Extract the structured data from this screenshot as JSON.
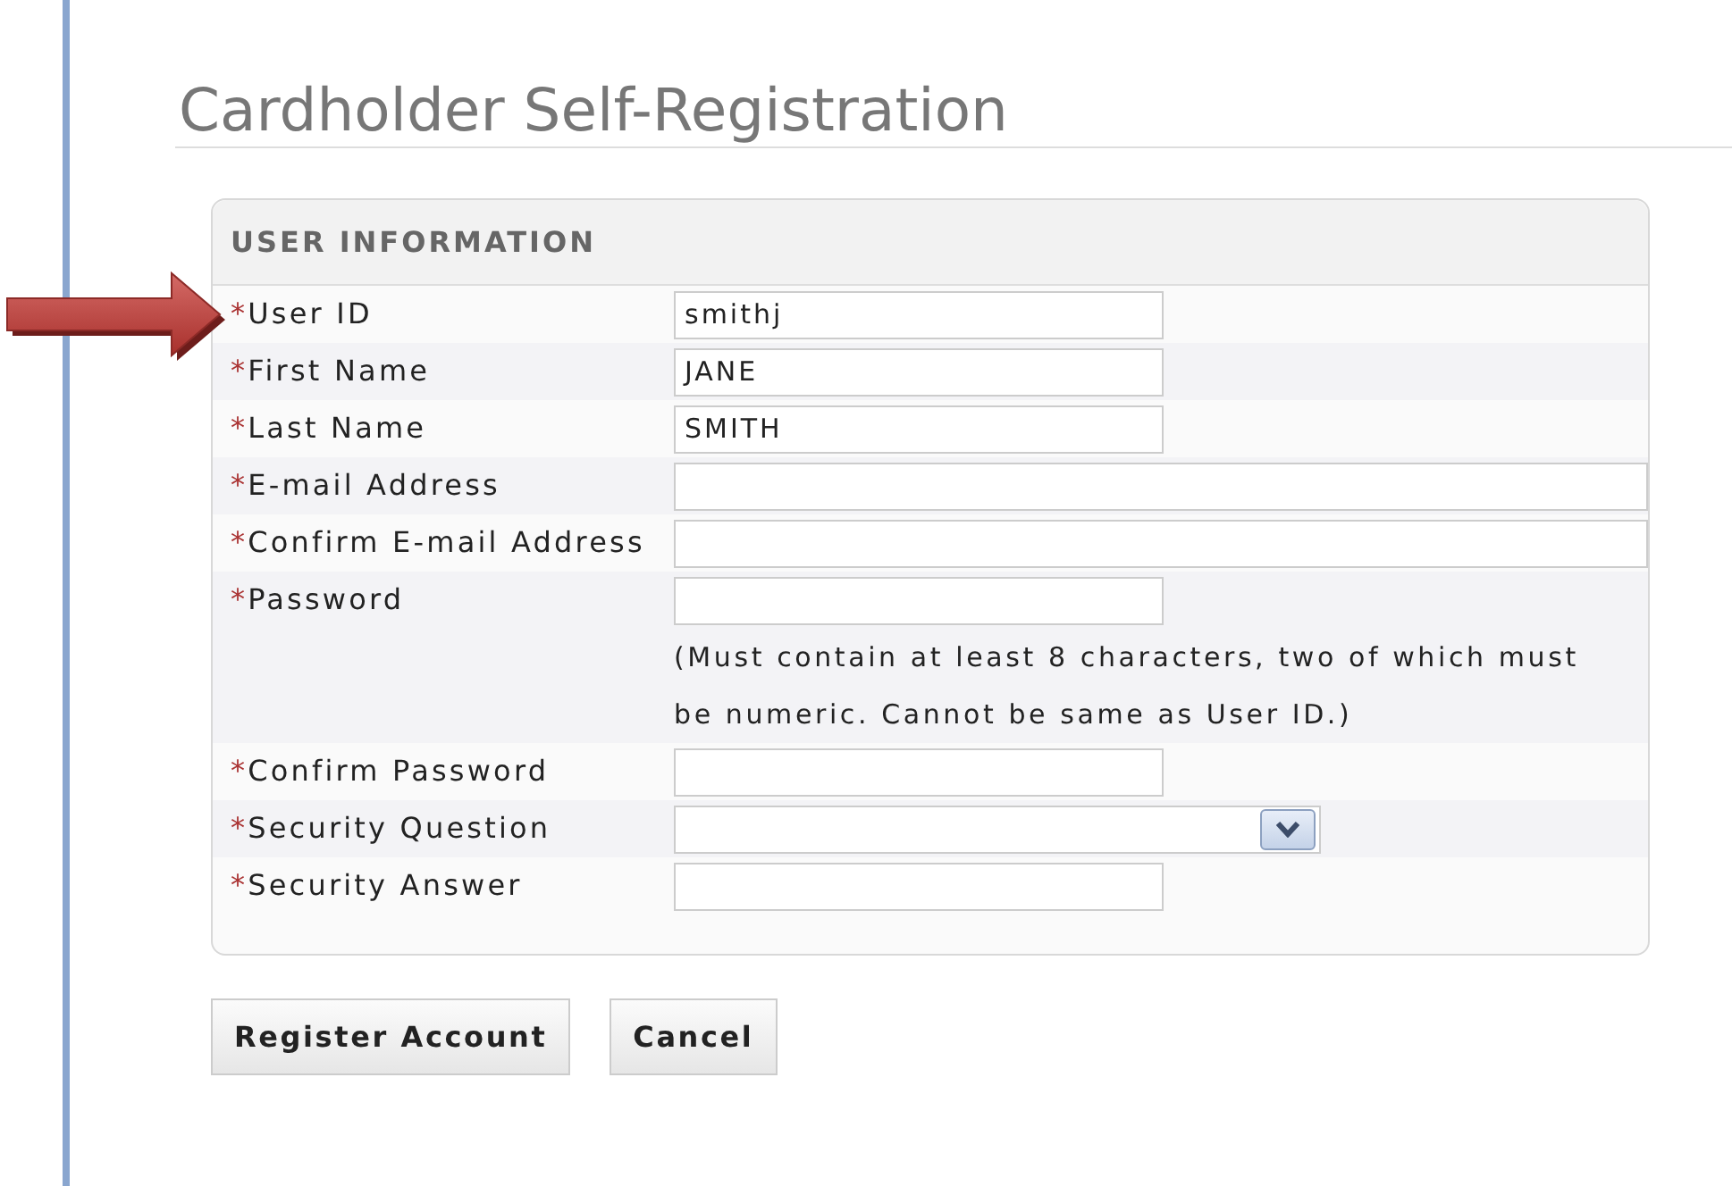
{
  "page": {
    "title": "Cardholder Self-Registration"
  },
  "panel": {
    "heading": "USER INFORMATION",
    "fields": [
      {
        "mark": "*",
        "label": "User ID",
        "kind": "short",
        "value": "smithj"
      },
      {
        "mark": "*",
        "label": "First Name",
        "kind": "short",
        "value": "JANE"
      },
      {
        "mark": "*",
        "label": "Last Name",
        "kind": "short",
        "value": "SMITH"
      },
      {
        "mark": "*",
        "label": "E-mail Address",
        "kind": "wide"
      },
      {
        "mark": "*",
        "label": "Confirm E-mail Address",
        "kind": "wide"
      },
      {
        "mark": "*",
        "label": "Password",
        "kind": "short",
        "hint": "(Must contain at least 8 characters, two of which must be numeric. Cannot be same as User ID.)"
      },
      {
        "mark": "*",
        "label": "Confirm Password",
        "kind": "short"
      },
      {
        "mark": "*",
        "label": "Security Question",
        "kind": "select"
      },
      {
        "mark": "*",
        "label": "Security Answer",
        "kind": "short"
      }
    ]
  },
  "buttons": [
    "Register Account",
    "Cancel"
  ]
}
